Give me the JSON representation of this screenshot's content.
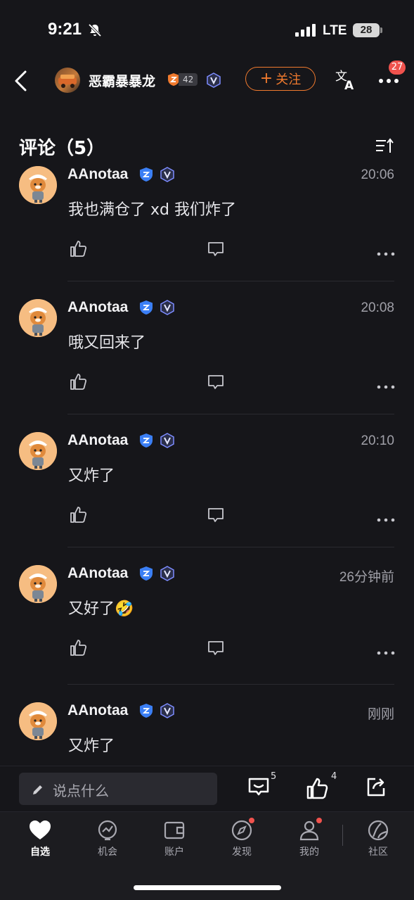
{
  "status_bar": {
    "time": "9:21",
    "network": "LTE",
    "battery": "28"
  },
  "header": {
    "username": "恶霸暴暴龙",
    "level": "42",
    "follow_label": "关注",
    "notification_count": "27"
  },
  "comments_section": {
    "title": "评论（5）",
    "comments": [
      {
        "author": "AAnotaa",
        "time": "20:06",
        "text": "我也满仓了 xd 我们炸了"
      },
      {
        "author": "AAnotaa",
        "time": "20:08",
        "text": "哦又回来了"
      },
      {
        "author": "AAnotaa",
        "time": "20:10",
        "text": "又炸了"
      },
      {
        "author": "AAnotaa",
        "time": "26分钟前",
        "text": "又好了🤣"
      },
      {
        "author": "AAnotaa",
        "time": "刚刚",
        "text": "又炸了"
      }
    ]
  },
  "input_bar": {
    "placeholder": "说点什么",
    "comment_count": "5",
    "like_count": "4"
  },
  "tabbar": {
    "tabs": [
      {
        "label": "自选"
      },
      {
        "label": "机会"
      },
      {
        "label": "账户"
      },
      {
        "label": "发现"
      },
      {
        "label": "我的"
      },
      {
        "label": "社区"
      }
    ]
  },
  "colors": {
    "accent": "#f07a2e",
    "badge_red": "#f0524d",
    "verified_blue": "#3b7ff5",
    "background": "#16161a"
  }
}
